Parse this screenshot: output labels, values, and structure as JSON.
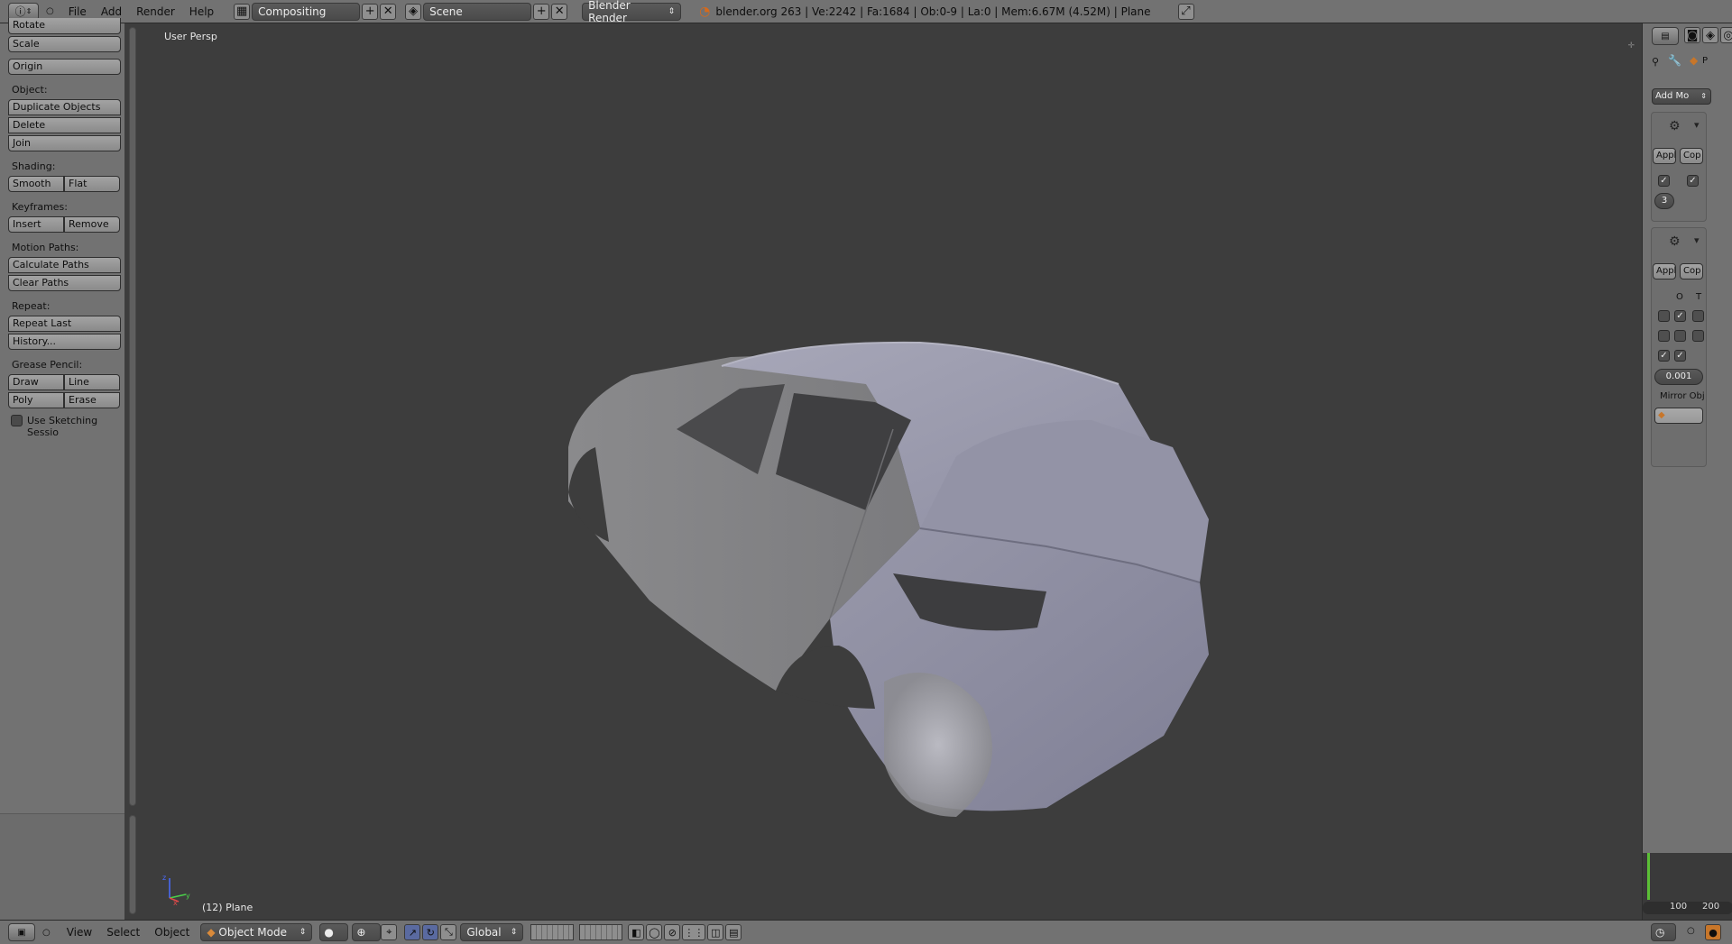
{
  "header": {
    "menus": [
      "File",
      "Add",
      "Render",
      "Help"
    ],
    "layout": "Compositing",
    "scene": "Scene",
    "engine": "Blender Render",
    "stats": "blender.org 263 | Ve:2242 | Fa:1684 | Ob:0-9 | La:0 | Mem:6.67M (4.52M) | Plane"
  },
  "toolshelf": {
    "top_partial": "Rotate",
    "scale": "Scale",
    "origin": "Origin",
    "object_label": "Object:",
    "duplicate": "Duplicate Objects",
    "delete": "Delete",
    "join": "Join",
    "shading_label": "Shading:",
    "smooth": "Smooth",
    "flat": "Flat",
    "keyframes_label": "Keyframes:",
    "insert": "Insert",
    "remove": "Remove",
    "motion_label": "Motion Paths:",
    "calc_paths": "Calculate Paths",
    "clear_paths": "Clear Paths",
    "repeat_label": "Repeat:",
    "repeat_last": "Repeat Last",
    "history": "History...",
    "grease_label": "Grease Pencil:",
    "draw": "Draw",
    "line": "Line",
    "poly": "Poly",
    "erase": "Erase",
    "sketch": "Use Sketching Sessio"
  },
  "viewport": {
    "view_name": "User Persp",
    "object_name": "(12) Plane",
    "axis_x": "x",
    "axis_y": "y",
    "axis_z": "z"
  },
  "properties": {
    "add_modifier": "Add Mo",
    "apply": "Appl",
    "copy": "Cop",
    "count": "3",
    "apply2": "Appl",
    "copy2": "Cop",
    "col_o": "O",
    "col_t": "T",
    "merge": "0.001",
    "mirror_obj": "Mirror Obj",
    "tab_p": "P"
  },
  "timeline": {
    "val_100": "100",
    "val_200": "200"
  },
  "bottombar": {
    "menus": [
      "View",
      "Select",
      "Object"
    ],
    "mode": "Object Mode",
    "orientation": "Global"
  },
  "colors": {
    "panel": "#727272",
    "viewport": "#3d3d3d",
    "car_body": "#9a9aad",
    "accent": "#5a6aa0"
  }
}
